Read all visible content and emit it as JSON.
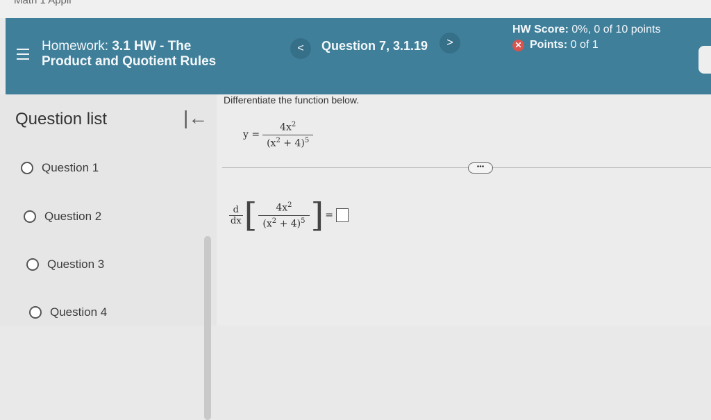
{
  "top_strip": {
    "crumb": "Math 1 Appli"
  },
  "header": {
    "homework_prefix": "Homework:",
    "homework_bold_1": "3.1 HW - The",
    "homework_bold_2": "Product and Quotient Rules",
    "prev_label": "<",
    "next_label": ">",
    "question_title": "Question 7, 3.1.19",
    "hw_score_label": "HW Score:",
    "hw_score_value": "0%, 0 of 10 points",
    "points_label": "Points:",
    "points_value": "0 of 1"
  },
  "sidebar": {
    "title": "Question list",
    "collapse_label": "|←",
    "questions": [
      "Question 1",
      "Question 2",
      "Question 3",
      "Question 4"
    ]
  },
  "content": {
    "prompt": "Differentiate the function below.",
    "y_label": "y =",
    "numerator": "4x",
    "numerator_exp": "2",
    "denominator_base": "(x",
    "denominator_inner_exp": "2",
    "denominator_rest": " + 4)",
    "denominator_exp": "5",
    "more_label": "•••",
    "d_label": "d",
    "dx_label": "dx",
    "equals": "="
  }
}
